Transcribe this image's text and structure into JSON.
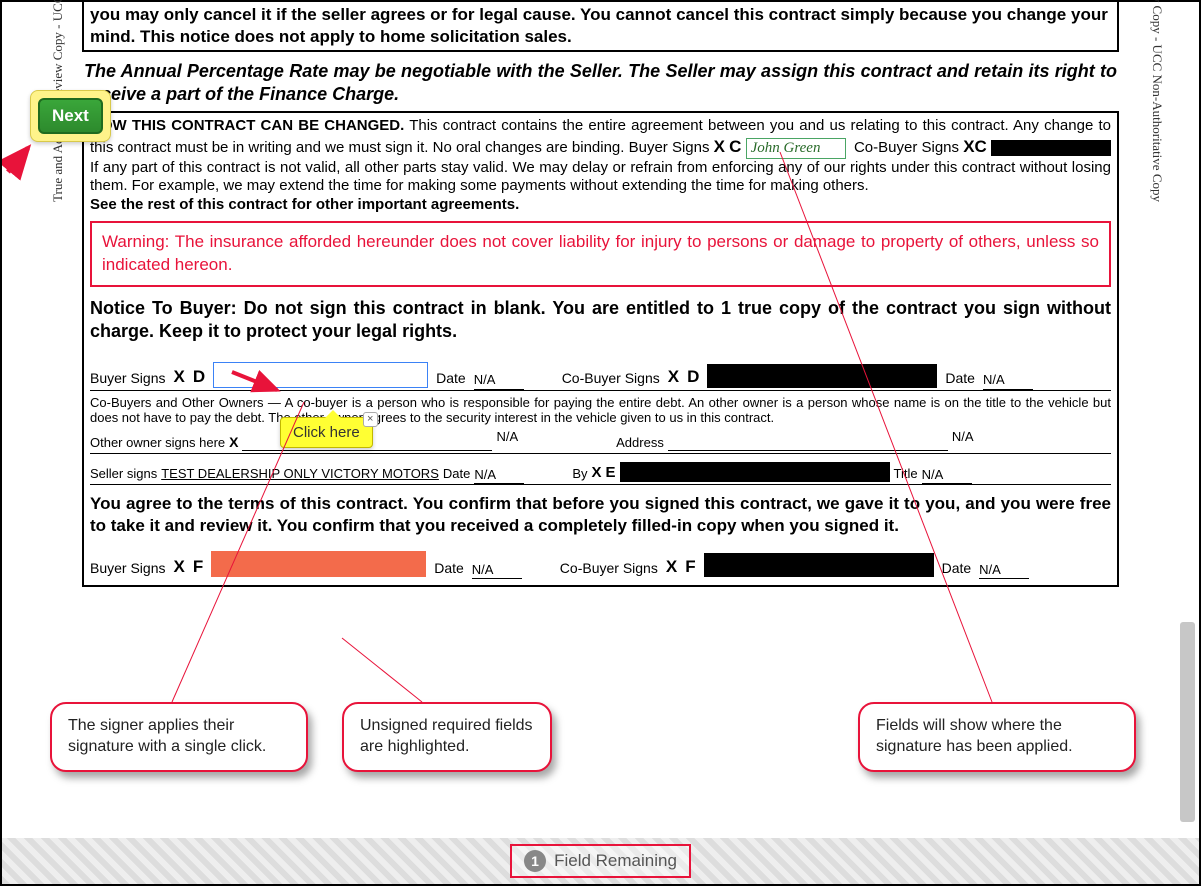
{
  "next_button": "Next",
  "tooltip_click_here": "Click here",
  "side_copy_text": "True and Accurate Review Copy - UCC Non-Authoritative Copy",
  "callouts": {
    "signer_click": "The signer applies their signature with a single click.",
    "unsigned_highlight": "Unsigned required fields are highlighted.",
    "fields_show": "Fields will show where the signature has been applied."
  },
  "footer": {
    "count": "1",
    "label": "Field Remaining"
  },
  "contract": {
    "cancel_notice": "you may only cancel it if the seller agrees or for legal cause. You cannot cancel this contract simply because you change your mind. This notice does not apply to home solicitation sales.",
    "negotiable": "The Annual Percentage Rate may be negotiable with the Seller. The Seller may assign this contract and retain its right to receive a part of the Finance Charge.",
    "how_changed_hdr": "HOW THIS CONTRACT CAN BE CHANGED.",
    "how_changed_1": " This contract contains the entire agreement between you and us relating to this contract. Any change to this contract must be in writing and we must sign it. No oral changes are binding. Buyer Signs ",
    "how_changed_2": "If any part of this contract is not valid, all other parts stay valid. We may delay or refrain from enforcing any of our rights under this contract without losing them. For example, we may extend the time for making some payments without extending the time for making others.",
    "see_rest": "See the rest of this contract for other important agreements.",
    "warning": "Warning: The insurance afforded hereunder does not cover liability for injury to persons or damage to property of others, unless so indicated hereon.",
    "notice_buyer": "Notice To Buyer: Do not sign this contract in blank. You are entitled to 1 true copy of the contract you sign without charge. Keep it to protect your legal rights.",
    "cobuyer_fine": "Co-Buyers and Other Owners — A co-buyer is a person who is responsible for paying the entire debt. An other owner is a person whose name is on the title to the vehicle but does not have to pay the debt. The other owner agrees to the security interest in the vehicle given to us in this contract.",
    "agree_terms": "You agree to the terms of this contract. You confirm that before you signed this contract, we gave it to you, and you were free to take it and review it. You confirm that you received a completely filled-in copy when you signed it.",
    "labels": {
      "buyer_signs": "Buyer Signs",
      "cobuyer_signs": "Co-Buyer Signs",
      "date": "Date",
      "other_owner": "Other owner signs here",
      "address": "Address",
      "seller_signs": "Seller signs",
      "by": "By",
      "title": "Title",
      "na": "N/A"
    },
    "signatures": {
      "buyer_c_name": "John Green",
      "seller_name": "TEST DEALERSHIP ONLY VICTORY MOTORS",
      "letters": {
        "c": "C",
        "d": "D",
        "e": "E",
        "f": "F"
      }
    }
  }
}
